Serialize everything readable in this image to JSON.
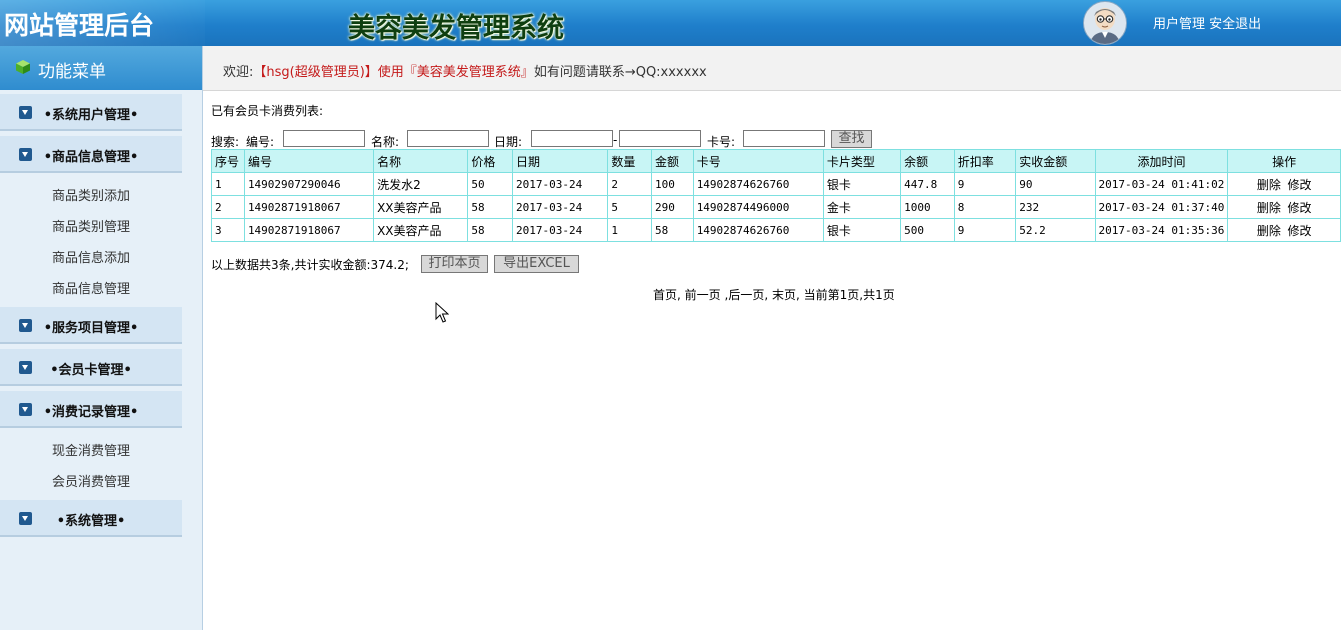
{
  "header": {
    "brand": "网站管理后台",
    "system_title": "美容美发管理系统",
    "user_manage": "用户管理",
    "logout": "安全退出"
  },
  "sidebar": {
    "heading": "功能菜单",
    "groups": [
      {
        "title": "•系统用户管理•",
        "items": []
      },
      {
        "title": "•商品信息管理•",
        "items": [
          "商品类别添加",
          "商品类别管理",
          "商品信息添加",
          "商品信息管理"
        ]
      },
      {
        "title": "•服务项目管理•",
        "items": []
      },
      {
        "title": "•会员卡管理•",
        "items": []
      },
      {
        "title": "•消费记录管理•",
        "items": [
          "现金消费管理",
          "会员消费管理"
        ]
      },
      {
        "title": "•系统管理•",
        "items": []
      }
    ]
  },
  "welcome": {
    "prefix": "欢迎:",
    "user": "【hsg(超级管理员)】使用『美容美发管理系统』",
    "suffix": "如有问题请联系→QQ:xxxxxx"
  },
  "main": {
    "caption": "已有会员卡消费列表:",
    "search": {
      "label": "搜索:",
      "code_label": "编号:",
      "name_label": "名称:",
      "date_label": "日期:",
      "date_sep": "-",
      "card_label": "卡号:",
      "find_button": "查找"
    },
    "table": {
      "headers": [
        "序号",
        "编号",
        "名称",
        "价格",
        "日期",
        "数量",
        "金额",
        "卡号",
        "卡片类型",
        "余额",
        "折扣率",
        "实收金额",
        "添加时间",
        "操作"
      ],
      "rows": [
        [
          "1",
          "14902907290046",
          "洗发水2",
          "50",
          "2017-03-24",
          "2",
          "100",
          "14902874626760",
          "银卡",
          "447.8",
          "9",
          "90",
          "2017-03-24 01:41:02"
        ],
        [
          "2",
          "14902871918067",
          "XX美容产品",
          "58",
          "2017-03-24",
          "5",
          "290",
          "14902874496000",
          "金卡",
          "1000",
          "8",
          "232",
          "2017-03-24 01:37:40"
        ],
        [
          "3",
          "14902871918067",
          "XX美容产品",
          "58",
          "2017-03-24",
          "1",
          "58",
          "14902874626760",
          "银卡",
          "500",
          "9",
          "52.2",
          "2017-03-24 01:35:36"
        ]
      ],
      "delete_label": "删除",
      "edit_label": "修改"
    },
    "summary": "以上数据共3条,共计实收金额:374.2;",
    "print_button": "打印本页",
    "export_button": "导出EXCEL",
    "pager": {
      "first": "首页",
      "prev": "前一页",
      "next": "后一页",
      "last": "末页",
      "status": "当前第1页,共1页"
    }
  }
}
